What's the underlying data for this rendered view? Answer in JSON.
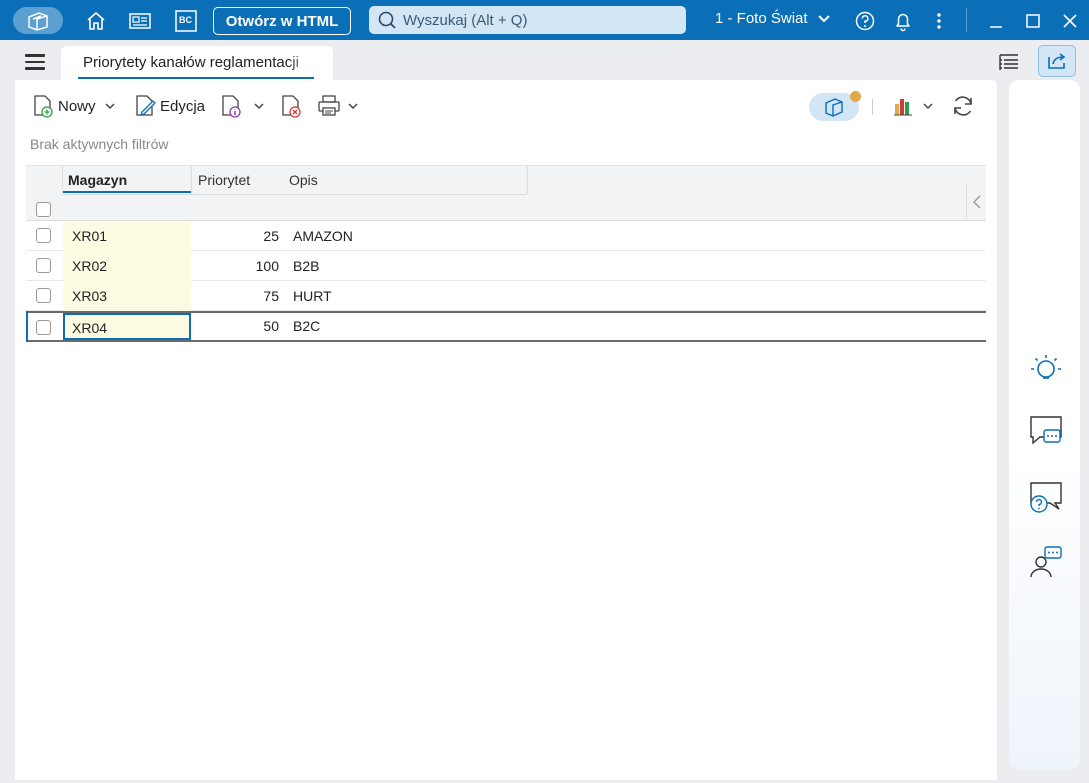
{
  "titlebar": {
    "open_html_label": "Otwórz w HTML",
    "search_placeholder": "Wyszukaj (Alt + Q)",
    "company": "1 - Foto Świat",
    "bc_label": "BC"
  },
  "tab": {
    "title": "Priorytety kanałów reglamentacji"
  },
  "toolbar": {
    "new_label": "Nowy",
    "edit_label": "Edycja"
  },
  "filter_status": "Brak aktywnych filtrów",
  "grid": {
    "columns": [
      "Magazyn",
      "Priorytet",
      "Opis"
    ],
    "rows": [
      {
        "magazyn": "XR01",
        "priorytet": "25",
        "opis": "AMAZON"
      },
      {
        "magazyn": "XR02",
        "priorytet": "100",
        "opis": "B2B"
      },
      {
        "magazyn": "XR03",
        "priorytet": "75",
        "opis": "HURT"
      },
      {
        "magazyn": "XR04",
        "priorytet": "50",
        "opis": "B2C"
      }
    ],
    "selected_row": 3
  },
  "colors": {
    "accent": "#0a6fb7",
    "highlight_column": "#fdfce3",
    "badge_dot": "#e0a848"
  },
  "icons": [
    "app-logo-icon",
    "home-icon",
    "news-icon",
    "bc-icon",
    "search-icon",
    "chevron-down-icon",
    "help-icon",
    "bell-icon",
    "more-icon",
    "minimize-icon",
    "maximize-icon",
    "close-icon",
    "hamburger-icon",
    "tree-list-icon",
    "share-icon",
    "new-doc-icon",
    "edit-doc-icon",
    "info-doc-icon",
    "delete-doc-icon",
    "print-icon",
    "chart-icon",
    "refresh-icon",
    "lightbulb-icon",
    "chat-icon",
    "help-chat-icon",
    "support-icon"
  ]
}
